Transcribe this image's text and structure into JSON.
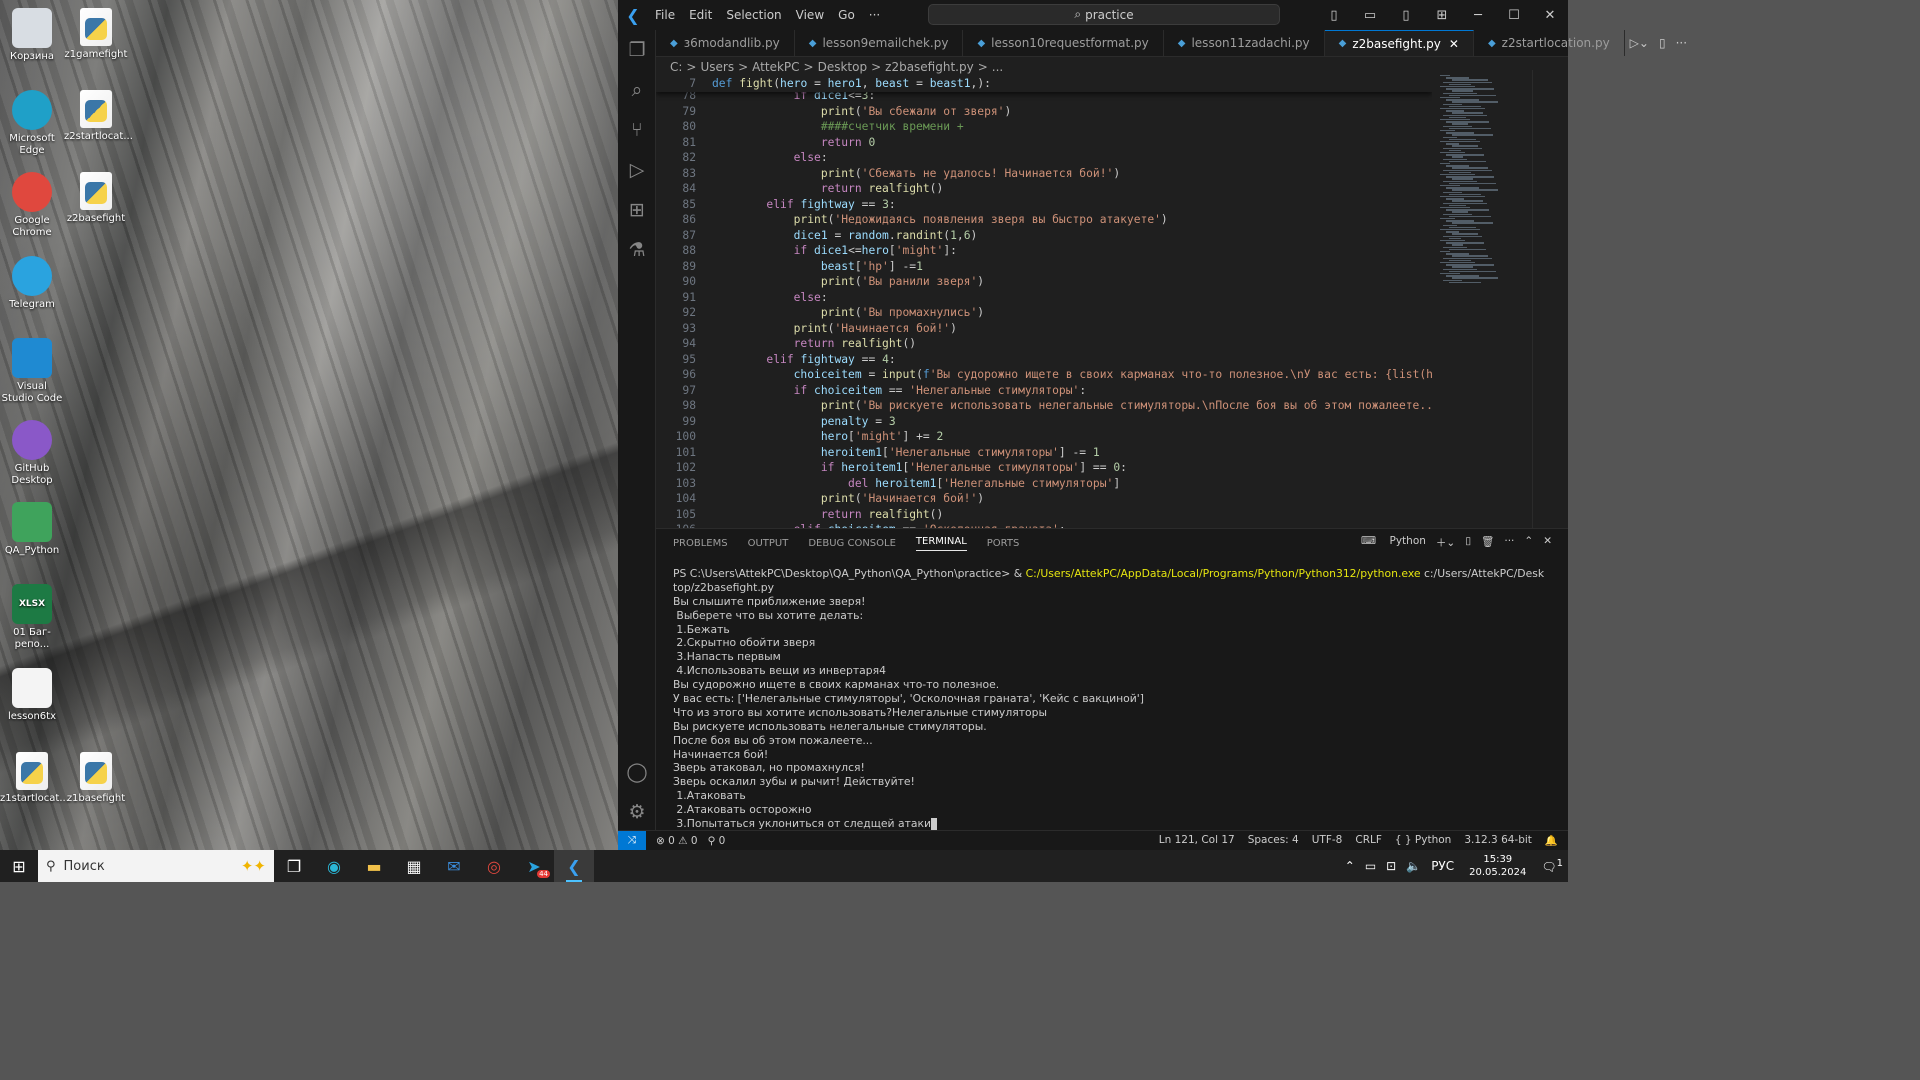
{
  "desktop": {
    "icons": [
      {
        "label": "Корзина",
        "icon": "recycle-bin-icon",
        "color": "#d8dde3"
      },
      {
        "label": "z1gamefight",
        "icon": "python-file-icon",
        "color": "#ffffff"
      },
      {
        "label": "Microsoft Edge",
        "icon": "edge-icon",
        "color": "#1fa0c8"
      },
      {
        "label": "z2startlocat...",
        "icon": "python-file-icon",
        "color": "#ffffff"
      },
      {
        "label": "Google Chrome",
        "icon": "chrome-icon",
        "color": "#e0483e"
      },
      {
        "label": "z2basefight",
        "icon": "python-file-icon",
        "color": "#ffffff"
      },
      {
        "label": "Telegram",
        "icon": "telegram-icon",
        "color": "#2aa3df"
      },
      {
        "label": "Visual Studio Code",
        "icon": "vscode-icon",
        "color": "#1f8ad2"
      },
      {
        "label": "GitHub Desktop",
        "icon": "github-desktop-icon",
        "color": "#8a58c8"
      },
      {
        "label": "QA_Python",
        "icon": "folder-icon",
        "color": "#3fa35c"
      },
      {
        "label": "01 Баг-репо...",
        "icon": "xlsx-icon",
        "color": "#1d7a44"
      },
      {
        "label": "lesson6tx",
        "icon": "text-file-icon",
        "color": "#f4f4f4"
      },
      {
        "label": "z1startlocat...",
        "icon": "python-file-icon",
        "color": "#ffffff"
      },
      {
        "label": "z1basefight",
        "icon": "python-file-icon",
        "color": "#ffffff"
      }
    ],
    "xlsx_text": "XLSX"
  },
  "titlebar": {
    "menu": [
      "File",
      "Edit",
      "Selection",
      "View",
      "Go",
      "···"
    ],
    "search": "practice",
    "back": "←",
    "forward": "→",
    "search_icon": "⌕"
  },
  "tabs": [
    {
      "label": "з6modandlib.py",
      "active": false
    },
    {
      "label": "lesson9emailchek.py",
      "active": false
    },
    {
      "label": "lesson10requestformat.py",
      "active": false
    },
    {
      "label": "lesson11zadachi.py",
      "active": false
    },
    {
      "label": "z2basefight.py",
      "active": true
    },
    {
      "label": "z2startlocation.py",
      "active": false
    }
  ],
  "breadcrumb": [
    "C:",
    ">",
    "Users",
    ">",
    "AttekPC",
    ">",
    "Desktop",
    ">",
    "z2basefight.py",
    ">",
    "..."
  ],
  "editor": {
    "sticky": {
      "num": "7",
      "code": "def fight(hero = hero1, beast = beast1,):"
    },
    "lines": [
      {
        "num": "78",
        "code": "            if dice1<=3:"
      },
      {
        "num": "79",
        "code": "                print('Вы сбежали от зверя')"
      },
      {
        "num": "80",
        "code": "                ####счетчик времени +"
      },
      {
        "num": "81",
        "code": "                return 0"
      },
      {
        "num": "82",
        "code": "            else:"
      },
      {
        "num": "83",
        "code": "                print('Сбежать не удалось! Начинается бой!')"
      },
      {
        "num": "84",
        "code": "                return realfight()"
      },
      {
        "num": "85",
        "code": "        elif fightway == 3:"
      },
      {
        "num": "86",
        "code": "            print('Недожидаясь появления зверя вы быстро атакуете')"
      },
      {
        "num": "87",
        "code": "            dice1 = random.randint(1,6)"
      },
      {
        "num": "88",
        "code": "            if dice1<=hero['might']:"
      },
      {
        "num": "89",
        "code": "                beast['hp'] -=1"
      },
      {
        "num": "90",
        "code": "                print('Вы ранили зверя')"
      },
      {
        "num": "91",
        "code": "            else:"
      },
      {
        "num": "92",
        "code": "                print('Вы промахнулись')"
      },
      {
        "num": "93",
        "code": "            print('Начинается бой!')"
      },
      {
        "num": "94",
        "code": "            return realfight()"
      },
      {
        "num": "95",
        "code": "        elif fightway == 4:"
      },
      {
        "num": "96",
        "code": "            choiceitem = input(f'Вы судорожно ищете в своих карманах что-то полезное.\\nУ вас есть: {list(heroitem1.keys("
      },
      {
        "num": "97",
        "code": "            if choiceitem == 'Нелегальные стимуляторы':"
      },
      {
        "num": "98",
        "code": "                print('Вы рискуете использовать нелегальные стимуляторы.\\nПосле боя вы об этом пожалеете...')"
      },
      {
        "num": "99",
        "code": "                penalty = 3"
      },
      {
        "num": "100",
        "code": "                hero['might'] += 2"
      },
      {
        "num": "101",
        "code": "                heroitem1['Нелегальные стимуляторы'] -= 1"
      },
      {
        "num": "102",
        "code": "                if heroitem1['Нелегальные стимуляторы'] == 0:"
      },
      {
        "num": "103",
        "code": "                    del heroitem1['Нелегальные стимуляторы']"
      },
      {
        "num": "104",
        "code": "                print('Начинается бой!')"
      },
      {
        "num": "105",
        "code": "                return realfight()"
      },
      {
        "num": "106",
        "code": "            elif choiceitem == 'Осколочная граната':"
      }
    ]
  },
  "panel": {
    "tabs": [
      "PROBLEMS",
      "OUTPUT",
      "DEBUG CONSOLE",
      "TERMINAL",
      "PORTS"
    ],
    "active_tab": "TERMINAL",
    "shell": "Python",
    "terminal": {
      "prompt_path": "PS C:\\Users\\AttekPC\\Desktop\\QA_Python\\QA_Python\\practice> & ",
      "prompt_exe": "C:/Users/AttekPC/AppData/Local/Programs/Python/Python312/python.exe",
      "prompt_arg": " c:/Users/AttekPC/Desk",
      "lines": [
        "top/z2basefight.py",
        "Вы слышите приближение зверя!",
        " Выберете что вы хотите делать:",
        " 1.Бежать",
        " 2.Скрытно обойти зверя",
        " 3.Напасть первым",
        " 4.Использовать вещи из инвертаря4",
        "Вы судорожно ищете в своих карманах что-то полезное.",
        "У вас есть: ['Нелегальные стимуляторы', 'Осколочная граната', 'Кейс с вакциной']",
        "Что из этого вы хотите использовать?Нелегальные стимуляторы",
        "Вы рискуете использовать нелегальные стимуляторы.",
        "После боя вы об этом пожалеете...",
        "Начинается бой!",
        "Зверь атаковал, но промахнулся!",
        "Зверь оскалил зубы и рычит! Действуйте!",
        " 1.Атаковать",
        " 2.Атаковать осторожно",
        " 3.Попытаться уклониться от следщей атаки"
      ]
    }
  },
  "statusbar": {
    "errors": "⊗ 0 ⚠ 0",
    "ports": "⚲ 0",
    "position": "Ln 121, Col 17",
    "spaces": "Spaces: 4",
    "encoding": "UTF-8",
    "eol": "CRLF",
    "language": "{ } Python",
    "interpreter": "3.12.3 64-bit"
  },
  "taskbar": {
    "search_placeholder": "Поиск",
    "telegram_badge": "44",
    "language": "РУС",
    "time": "15:39",
    "date": "20.05.2024",
    "notifications": "1"
  }
}
